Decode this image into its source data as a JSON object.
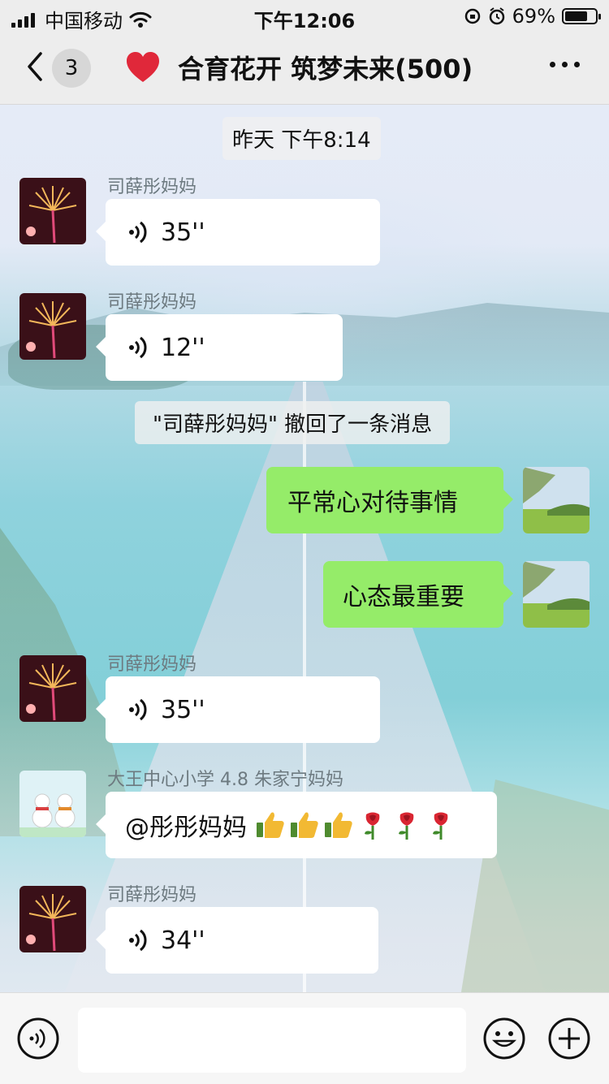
{
  "status_bar": {
    "carrier": "中国移动",
    "time": "下午12:06",
    "battery_percent": "69%",
    "battery_level": 0.69
  },
  "header": {
    "unread_count": "3",
    "title": "合育花开 筑梦未来(500)"
  },
  "messages": {
    "timestamp": "昨天 下午8:14",
    "m1": {
      "sender": "司薛彤妈妈",
      "duration": "35''"
    },
    "m2": {
      "sender": "司薛彤妈妈",
      "duration": "12''"
    },
    "recall_notice": "\"司薛彤妈妈\" 撤回了一条消息",
    "m3": {
      "text": "平常心对待事情"
    },
    "m4": {
      "text": "心态最重要"
    },
    "m5": {
      "sender": "司薛彤妈妈",
      "duration": "35''"
    },
    "m6": {
      "sender": "大王中心小学 4.8 朱家宁妈妈",
      "text": "@彤彤妈妈",
      "emojis": [
        "thumbs-up-icon",
        "thumbs-up-icon",
        "thumbs-up-icon",
        "rose-icon",
        "rose-icon",
        "rose-icon"
      ]
    },
    "m7": {
      "sender": "司薛彤妈妈",
      "duration": "34''"
    }
  },
  "input_bar": {
    "value": ""
  },
  "colors": {
    "sent_bubble": "#95ec69",
    "received_bubble": "#ffffff",
    "header_bg": "#ededed"
  }
}
